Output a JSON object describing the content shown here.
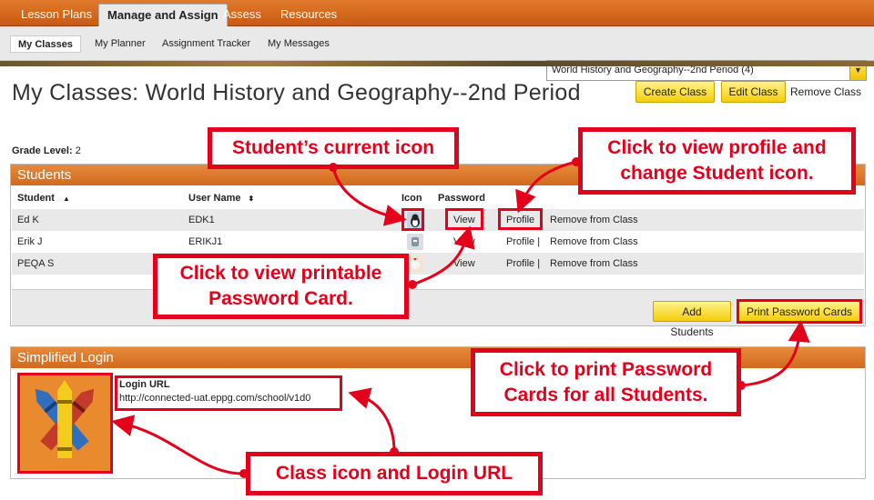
{
  "nav": {
    "tabs": [
      {
        "label": "Lesson Plans"
      },
      {
        "label": "Manage and Assign"
      },
      {
        "label": "Assess"
      },
      {
        "label": "Resources"
      }
    ],
    "subtabs": [
      {
        "label": "My Classes"
      },
      {
        "label": "My Planner"
      },
      {
        "label": "Assignment Tracker"
      },
      {
        "label": "My Messages"
      }
    ],
    "class_select": "World History and Geography--2nd Period (4)"
  },
  "header": {
    "title": "My Classes: World History and Geography--2nd Period",
    "create_class": "Create Class",
    "edit_class": "Edit Class",
    "remove_class": "Remove Class",
    "grade_label": "Grade Level:",
    "grade_value": "2"
  },
  "students": {
    "heading": "Students",
    "columns": {
      "student": "Student",
      "username": "User Name",
      "icon": "Icon",
      "password": "Password"
    },
    "rows": [
      {
        "name": "Ed K",
        "username": "EDK1",
        "password": "View",
        "profile": "Profile",
        "remove": "Remove from Class"
      },
      {
        "name": "Erik J",
        "username": "ERIKJ1",
        "password": "View",
        "profile": "Profile |",
        "remove": "Remove from Class"
      },
      {
        "name": "PEQA S",
        "username": "",
        "password": "View",
        "profile": "Profile |",
        "remove": "Remove from Class"
      }
    ],
    "add_students": "Add Students",
    "print_cards": "Print Password Cards"
  },
  "login": {
    "heading": "Simplified Login",
    "url_label": "Login URL",
    "url": "http://connected-uat.eppg.com/school/v1d0"
  },
  "callouts": {
    "current_icon": "Student’s current icon",
    "profile_line1": "Click to view profile and",
    "profile_line2": "change Student icon.",
    "password_line1": "Click to view printable",
    "password_line2": "Password Card.",
    "print_line1": "Click to print Password",
    "print_line2": "Cards for all Students.",
    "class_icon": "Class icon and Login URL"
  },
  "colors": {
    "nav_orange": "#d2691e",
    "accent_red": "#e4001b",
    "button_yellow": "#f4cd0b"
  }
}
